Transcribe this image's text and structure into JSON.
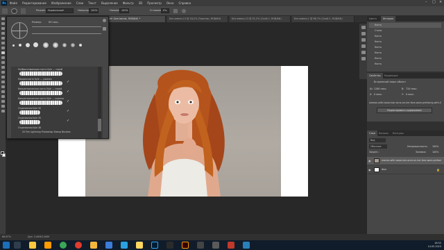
{
  "menu": {
    "app_icon": "Ps",
    "items": [
      "Файл",
      "Редактирование",
      "Изображение",
      "Слои",
      "Текст",
      "Выделение",
      "Фильтр",
      "3D",
      "Просмотр",
      "Окно",
      "Справка"
    ]
  },
  "options": {
    "mode_label": "Режим:",
    "mode_value": "Нормальный",
    "opacity_label": "Непрозр.:",
    "opacity_value": "100%",
    "flow_label": "Нажим:",
    "flow_value": "100%",
    "smooth_label": "Сглаживание:",
    "smooth_value": "0%"
  },
  "tabs": [
    {
      "label": "...with Sam bands, RGB/8#) *",
      "active": true
    },
    {
      "label": "Без имени-13 @ 16,2% (Триснер, RGB/8#)",
      "active": false
    },
    {
      "label": "Без имени-13 @ 51,2% (Слой 1, RGB/8#)",
      "active": false
    },
    {
      "label": "Без имени-1 @ 66,7% (Слой 1, RGB/8#)",
      "active": false
    }
  ],
  "brush_panel": {
    "size_label": "Размер:",
    "size_value": "63 пикс.",
    "brushes": [
      {
        "name": "Разбрызгивающая кисть Kyle — спрей"
      },
      {
        "name": "Мокрая кисть Kyle — ужинка"
      },
      {
        "name": "Концентрическая кисть Kyle — спрей"
      },
      {
        "name": "Концентрическая кисть Kyle — ужинка"
      },
      {
        "name": "Отделочная Kyle 30"
      },
      {
        "name": "Отделочная Kyle 35"
      },
      {
        "name": "Отделочная Kyle 36"
      }
    ],
    "group_label": "20 Fire Lightning Photoshop Stamp Brushes"
  },
  "history": {
    "tabs": [
      "Цвета",
      "История"
    ],
    "items": [
      "Кисть",
      "Стиль",
      "Кисть",
      "Кисть",
      "Кисть",
      "Кисть",
      "Кисть",
      "Кисть"
    ]
  },
  "properties": {
    "tabs": [
      "Свойства",
      "Коррекция"
    ],
    "title": "Встроенный смарт-объект",
    "w_label": "Ш:",
    "w_value": "1280 пикс.",
    "h_label": "В:",
    "h_value": "720 пикс.",
    "x_label": "X:",
    "x_value": "0 пикс.",
    "y_label": "Y:",
    "y_value": "0 пикс.",
    "file_name": "woman-with-loose-hair-acne-on-her-face-wore-prefacing-with-Sam-bands",
    "button_label": "Редактировать содержимое"
  },
  "layers": {
    "tabs": [
      "Слои",
      "Каналы",
      "Контуры"
    ],
    "kind_label": "Вид",
    "blend": "Обычные",
    "opacity_label": "Непрозрачность:",
    "opacity_value": "100%",
    "lock_label": "Закреп.:",
    "fill_label": "Заливка:",
    "fill_value": "100%",
    "items": [
      {
        "name": "woman-with-loose-hair-acne-on-her-face-wore-prefacing-with-Sam",
        "selected": true
      },
      {
        "name": "Фон",
        "selected": false
      }
    ]
  },
  "status": {
    "zoom": "66,67%",
    "doc": "Док: 2,64М/2,64М"
  },
  "clock": {
    "time": "18:52",
    "date": "14.05.2023"
  },
  "colors": {
    "accent_ps": "#31a8ff",
    "panel": "#474747",
    "background": "#282828"
  }
}
